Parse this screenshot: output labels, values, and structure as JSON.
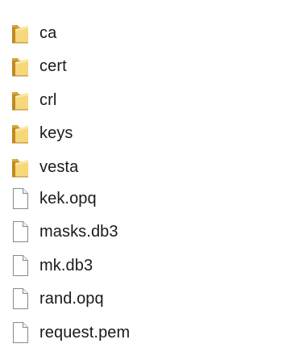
{
  "explorer": {
    "items": [
      {
        "name": "ca",
        "type": "folder",
        "icon": "folder-icon"
      },
      {
        "name": "cert",
        "type": "folder",
        "icon": "folder-icon"
      },
      {
        "name": "crl",
        "type": "folder",
        "icon": "folder-icon"
      },
      {
        "name": "keys",
        "type": "folder",
        "icon": "folder-icon"
      },
      {
        "name": "vesta",
        "type": "folder",
        "icon": "folder-icon"
      },
      {
        "name": "kek.opq",
        "type": "file",
        "icon": "file-icon"
      },
      {
        "name": "masks.db3",
        "type": "file",
        "icon": "file-icon"
      },
      {
        "name": "mk.db3",
        "type": "file",
        "icon": "file-icon"
      },
      {
        "name": "rand.opq",
        "type": "file",
        "icon": "file-icon"
      },
      {
        "name": "request.pem",
        "type": "file",
        "icon": "file-icon"
      }
    ]
  },
  "colors": {
    "folder_back": "#d9a63c",
    "folder_front": "#f6d77a",
    "folder_shadow": "#c08a23",
    "file_body": "#ffffff",
    "file_border": "#8a8a8a",
    "text": "#1a1a1a"
  }
}
